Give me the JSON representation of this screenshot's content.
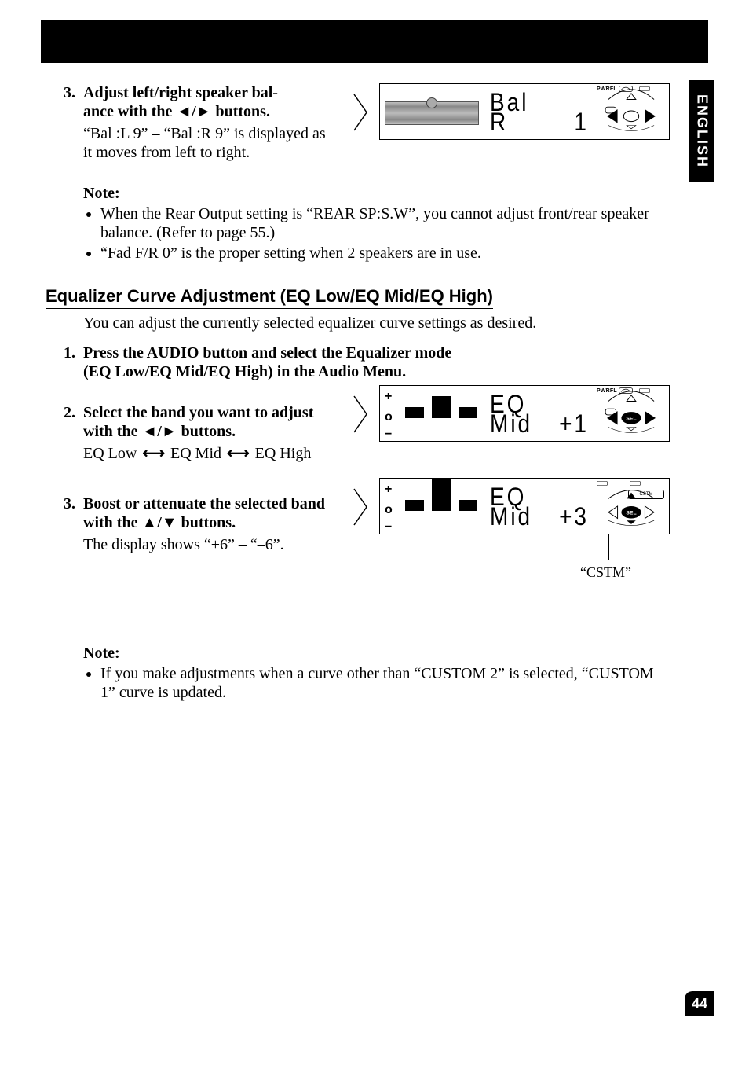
{
  "side_tab": "ENGLISH",
  "page_number": "44",
  "step3a": {
    "num": "3.",
    "title_a": "Adjust left/right speaker bal-",
    "title_b": "ance with the ",
    "title_c": " buttons.",
    "arrows": "◄/►",
    "body": "“Bal :L 9” – “Bal :R 9” is displayed as it moves from left to right."
  },
  "note1": {
    "label": "Note:",
    "items": [
      "When the Rear Output setting is “REAR SP:S.W”, you cannot adjust front/rear speaker balance. (Refer to page 55.)",
      "“Fad F/R 0” is the proper setting when 2 speakers are in use."
    ]
  },
  "heading": "Equalizer Curve Adjustment (EQ Low/EQ Mid/EQ High)",
  "intro": "You can adjust the currently selected equalizer curve settings as desired.",
  "step1b": {
    "num": "1.",
    "line1": "Press the AUDIO button and select the Equalizer mode",
    "line2": "(EQ Low/EQ Mid/EQ High) in the Audio Menu."
  },
  "step2b": {
    "num": "2.",
    "title_a": "Select the band you want to adjust with the ",
    "title_b": " buttons.",
    "arrows": "◄/►",
    "body_a": "EQ Low",
    "body_b": "EQ Mid",
    "body_c": "EQ High"
  },
  "step3b": {
    "num": "3.",
    "title_a": "Boost or attenuate the selected band with the ",
    "title_b": " buttons.",
    "arrows": "▲/▼",
    "body": "The display shows “+6” – “–6”."
  },
  "note2": {
    "label": "Note:",
    "items": [
      "If you make adjustments when a curve other than “CUSTOM 2” is selected, “CUSTOM 1” curve is updated."
    ]
  },
  "lcd1": {
    "top": "Bal",
    "bottom_a": "R",
    "bottom_b": "1",
    "pwrfl": "PWRFL"
  },
  "lcd2": {
    "top": "EQ",
    "bottom_a": "Mid",
    "bottom_b": "+1",
    "pwrfl": "PWRFL",
    "sel": "SEL"
  },
  "lcd3": {
    "top": "EQ",
    "bottom_a": "Mid",
    "bottom_b": "+3",
    "cstm": "CSTM",
    "sel": "SEL"
  },
  "cstm_caption": "“CSTM”"
}
